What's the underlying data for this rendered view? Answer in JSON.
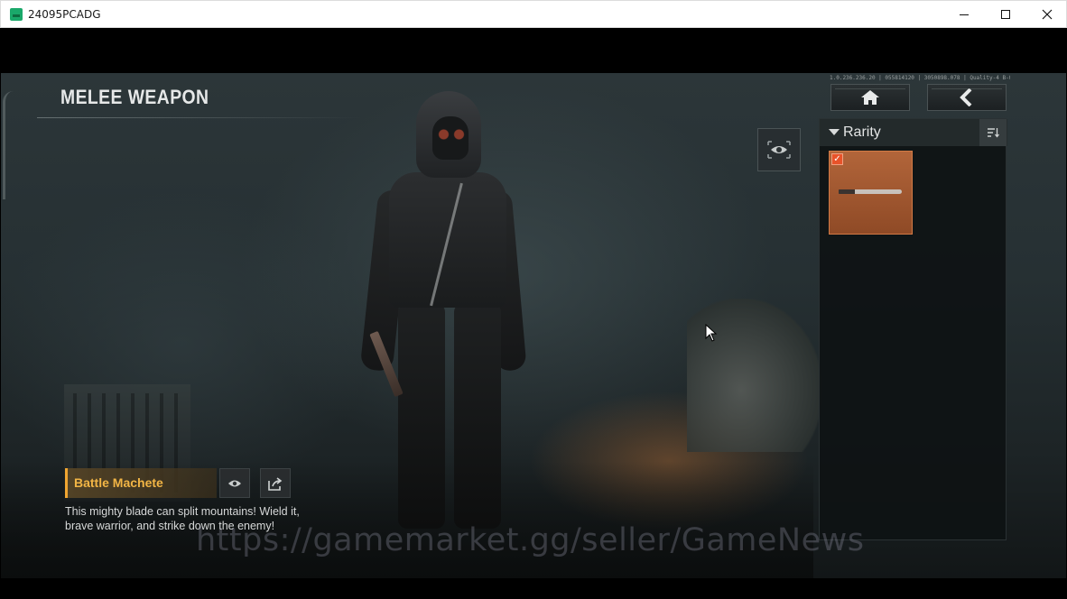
{
  "window": {
    "title": "24095PCADG",
    "minimize_icon": "minimize-icon",
    "maximize_icon": "maximize-icon",
    "close_icon": "close-icon"
  },
  "game": {
    "page_title": "MELEE WEAPON",
    "debug_info": "1.0.236.236.20 | 055814120 | 3050898.078 | Quality-4 B-01111-1:1sec",
    "top_nav": {
      "home_icon": "home-icon",
      "back_icon": "back-chevron-icon"
    },
    "preview_icon": "eye-icon",
    "filter": {
      "label": "Rarity",
      "sort_icon": "sort-icon"
    },
    "items": [
      {
        "name": "Battle Machete",
        "selected": true,
        "accent": "#b2653a"
      }
    ],
    "selected_item": {
      "name": "Battle Machete",
      "description": "This mighty blade can split mountains! Wield it, brave warrior, and strike down the enemy!",
      "view_icon": "eye-icon",
      "share_icon": "share-icon",
      "accent": "#f0a531"
    },
    "watermark": "https://gamemarket.gg/seller/GameNews"
  }
}
